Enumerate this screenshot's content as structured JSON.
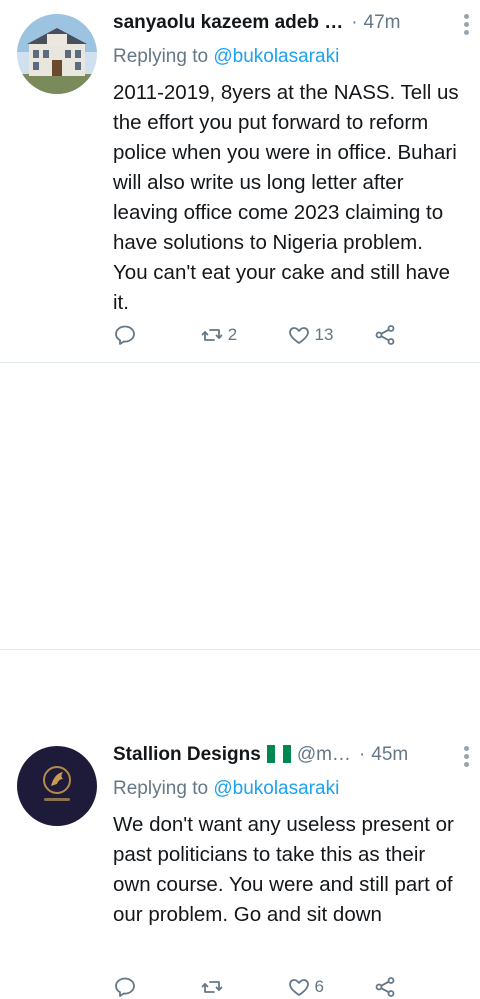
{
  "tweets": [
    {
      "name": "sanyaolu kazeem adeb …",
      "handle": "",
      "time": "47m",
      "replying_prefix": "Replying to",
      "replying_to": "@bukolasaraki",
      "text": "2011-2019, 8yers at the NASS. Tell us the effort you put forward to reform police when you were in office. Buhari will also write us long letter after leaving office come 2023 claiming to have solutions to Nigeria problem. You can't eat your cake and still have it.",
      "retweets": "2",
      "likes": "13",
      "avatar_icon": "building-photo-avatar"
    },
    {
      "name": "Stallion Designs",
      "handle": "@m…",
      "time": "45m",
      "replying_prefix": "Replying to",
      "replying_to": "@bukolasaraki",
      "text": "We don't want any useless present or past politicians to take this as their own course. You were and still part of our problem. Go and sit down",
      "retweets": "",
      "likes": "6",
      "avatar_icon": "stallion-logo-avatar"
    }
  ],
  "colors": {
    "accent": "#1da1f2",
    "secondary_text": "#657786",
    "divider": "#e1e8ed",
    "flag_green": "#008751"
  },
  "icons": [
    "comment-icon",
    "retweet-icon",
    "heart-icon",
    "share-icon",
    "more-vertical-icon",
    "nigeria-flag-icon"
  ]
}
